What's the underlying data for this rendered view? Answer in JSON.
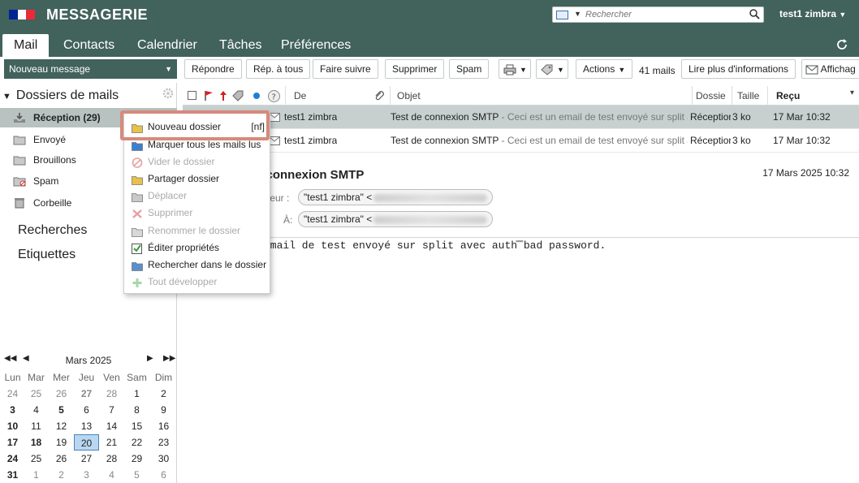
{
  "header": {
    "app_title": "MESSAGERIE",
    "search_placeholder": "Rechercher",
    "user": "test1 zimbra",
    "flag_colors": [
      "#002395",
      "#ffffff",
      "#ed2939"
    ]
  },
  "tabs": [
    {
      "label": "Mail",
      "active": true
    },
    {
      "label": "Contacts"
    },
    {
      "label": "Calendrier"
    },
    {
      "label": "Tâches"
    },
    {
      "label": "Préférences"
    }
  ],
  "toolbar": {
    "new_message": "Nouveau message",
    "reply": "Répondre",
    "reply_all": "Rép. à tous",
    "forward": "Faire suivre",
    "delete": "Supprimer",
    "spam": "Spam",
    "actions": "Actions",
    "mail_count": "41 mails",
    "more_info": "Lire plus d'informations",
    "display": "Affichag"
  },
  "sidebar": {
    "folders_header": "Dossiers de mails",
    "folders": [
      {
        "label": "Réception (29)",
        "icon": "inbox-icon",
        "selected": true
      },
      {
        "label": "Envoyé",
        "icon": "sent-folder-icon"
      },
      {
        "label": "Brouillons",
        "icon": "drafts-folder-icon"
      },
      {
        "label": "Spam",
        "icon": "spam-folder-icon"
      },
      {
        "label": "Corbeille",
        "icon": "trash-icon"
      }
    ],
    "searches": "Recherches",
    "tags": "Etiquettes"
  },
  "calendar": {
    "month": "Mars 2025",
    "days_of_week": [
      "Lun",
      "Mar",
      "Mer",
      "Jeu",
      "Ven",
      "Sam",
      "Dim"
    ],
    "weeks": [
      [
        "24",
        "25",
        "26",
        "27",
        "28",
        "1",
        "2"
      ],
      [
        "3",
        "4",
        "5",
        "6",
        "7",
        "8",
        "9"
      ],
      [
        "10",
        "11",
        "12",
        "13",
        "14",
        "15",
        "16"
      ],
      [
        "17",
        "18",
        "19",
        "20",
        "21",
        "22",
        "23"
      ],
      [
        "24",
        "25",
        "26",
        "27",
        "28",
        "29",
        "30"
      ],
      [
        "31",
        "1",
        "2",
        "3",
        "4",
        "5",
        "6"
      ]
    ],
    "today": "20"
  },
  "list": {
    "columns": {
      "from": "De",
      "subject": "Objet",
      "folder": "Dossie",
      "size": "Taille",
      "received": "Reçu"
    },
    "rows": [
      {
        "from": "test1 zimbra",
        "subject": "Test de connexion SMTP",
        "fragment": " - Ceci est un email de test envoyé sur split av",
        "folder": "Réception",
        "size": "3 ko",
        "date": "17 Mar 10:32",
        "selected": true
      },
      {
        "from": "test1 zimbra",
        "subject": "Test de connexion SMTP",
        "fragment": " - Ceci est un email de test envoyé sur split av",
        "folder": "Réception",
        "size": "3 ko",
        "date": "17 Mar 10:32"
      }
    ]
  },
  "message": {
    "subject": "e connexion SMTP",
    "date": "17 Mars 2025 10:32",
    "from_label": "teur :",
    "to_label": "À:",
    "from_name": "\"test1 zimbra\" <",
    "to_name": "\"test1 zimbra\" <",
    "body": "email de test envoyé sur split avec auth bad password."
  },
  "context_menu": {
    "items": [
      {
        "label": "Nouveau dossier",
        "shortcut": "[nf]",
        "icon": "new-folder-icon"
      },
      {
        "label": "Marquer tous les mails lus",
        "icon": "mark-read-icon"
      },
      {
        "label": "Vider le dossier",
        "icon": "empty-folder-icon",
        "disabled": true
      },
      {
        "label": "Partager dossier",
        "icon": "share-folder-icon"
      },
      {
        "label": "Déplacer",
        "icon": "move-icon",
        "disabled": true
      },
      {
        "label": "Supprimer",
        "icon": "delete-icon",
        "disabled": true
      },
      {
        "label": "Renommer le dossier",
        "icon": "rename-icon",
        "disabled": true
      },
      {
        "label": "Éditer propriétés",
        "icon": "edit-properties-icon"
      },
      {
        "label": "Rechercher dans le dossier",
        "icon": "search-folder-icon"
      },
      {
        "label": "Tout développer",
        "icon": "expand-all-icon",
        "disabled": true
      }
    ]
  }
}
